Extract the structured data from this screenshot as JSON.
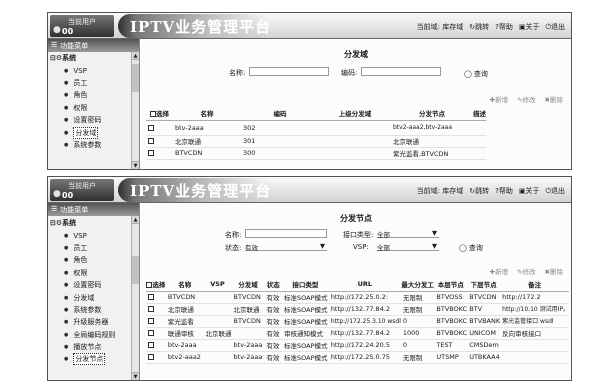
{
  "screen1": {
    "user_label": "当前用户",
    "user_name": "00",
    "app_title": "IPTV业务管理平台",
    "current_domain": "当前域: 库存域",
    "links": [
      "跳转",
      "帮助",
      "关于",
      "退出"
    ],
    "sidebar_header": "功能菜单",
    "sidebar": [
      "系统",
      "VSP",
      "员工",
      "角色",
      "权限",
      "设置密码",
      "分发域",
      "系统参数"
    ],
    "page_title": "分发域",
    "filters": {
      "name_label": "名称:",
      "code_label": "编码:",
      "query": "查询"
    },
    "actions": [
      "新增",
      "修改",
      "删除"
    ],
    "columns": [
      "选择",
      "名称",
      "编码",
      "上级分发域",
      "分发节点",
      "描述"
    ],
    "rows": [
      [
        "btv-2aaa",
        "302",
        "",
        "btv2-aaa2,btv-2aaa",
        ""
      ],
      [
        "北京联通",
        "301",
        "",
        "北京联通",
        ""
      ],
      [
        "BTVCDN",
        "300",
        "",
        "紫光监看,BTVCDN",
        ""
      ]
    ]
  },
  "screen2": {
    "user_label": "当前用户",
    "user_name": "00",
    "app_title": "IPTV业务管理平台",
    "current_domain": "当前域: 库存域",
    "links": [
      "跳转",
      "帮助",
      "关于",
      "退出"
    ],
    "sidebar_header": "功能菜单",
    "sidebar": [
      "系统",
      "VSP",
      "员工",
      "角色",
      "权限",
      "设置密码",
      "分发域",
      "系统参数",
      "升级服务器",
      "全局编码规则",
      "播放节点",
      "分发节点"
    ],
    "page_title": "分发节点",
    "filters": {
      "name_label": "名称:",
      "status_label": "状态:",
      "status_value": "有效",
      "type_label": "接口类型:",
      "type_value": "全部",
      "vsp_label": "VSP:",
      "vsp_value": "全部",
      "query": "查询"
    },
    "actions": [
      "新增",
      "修改",
      "删除"
    ],
    "columns": [
      "选择",
      "名称",
      "VSP",
      "分发域",
      "状态",
      "接口类型",
      "URL",
      "最大分发工",
      "本层节点",
      "下层节点",
      "备注"
    ],
    "rows": [
      [
        "BTVCDN",
        "",
        "BTVCDN",
        "有效",
        "标准SOAP模式",
        "http://172.25.0.2:",
        "无限制",
        "BTVOSS",
        "BTVCDN",
        "http://172.2"
      ],
      [
        "北京联通",
        "",
        "北京联通",
        "有效",
        "标准SOAP模式",
        "http://132.77.84.2",
        "无限制",
        "BTVBOKC",
        "BTV",
        "http://10.10 测试用IP。"
      ],
      [
        "紫光监看",
        "",
        "BTVCDN",
        "有效",
        "标准SOAP模式",
        "http://172.25.3.10 wsdl",
        "0",
        "BTVBOKC",
        "BTVBANK",
        "紫光监管接口 wsdl"
      ],
      [
        "联通审核",
        "北京联通",
        "",
        "有效",
        "审核通知模式",
        "http://132.77.84.2",
        "1000",
        "BTVBOKC",
        "UNICOM",
        "反向审核接口"
      ],
      [
        "btv-2aaa",
        "",
        "btv-2aaa",
        "有效",
        "标准SOAP模式",
        "http://172.24.20.5",
        "0",
        "TEST",
        "CMSDem",
        ""
      ],
      [
        "btv2-aaa2",
        "",
        "btv-2aaa",
        "有效",
        "标准SOAP模式",
        "http://172.25.0.75",
        "无限制",
        "UTSMP",
        "UTBKAA4",
        ""
      ]
    ]
  }
}
